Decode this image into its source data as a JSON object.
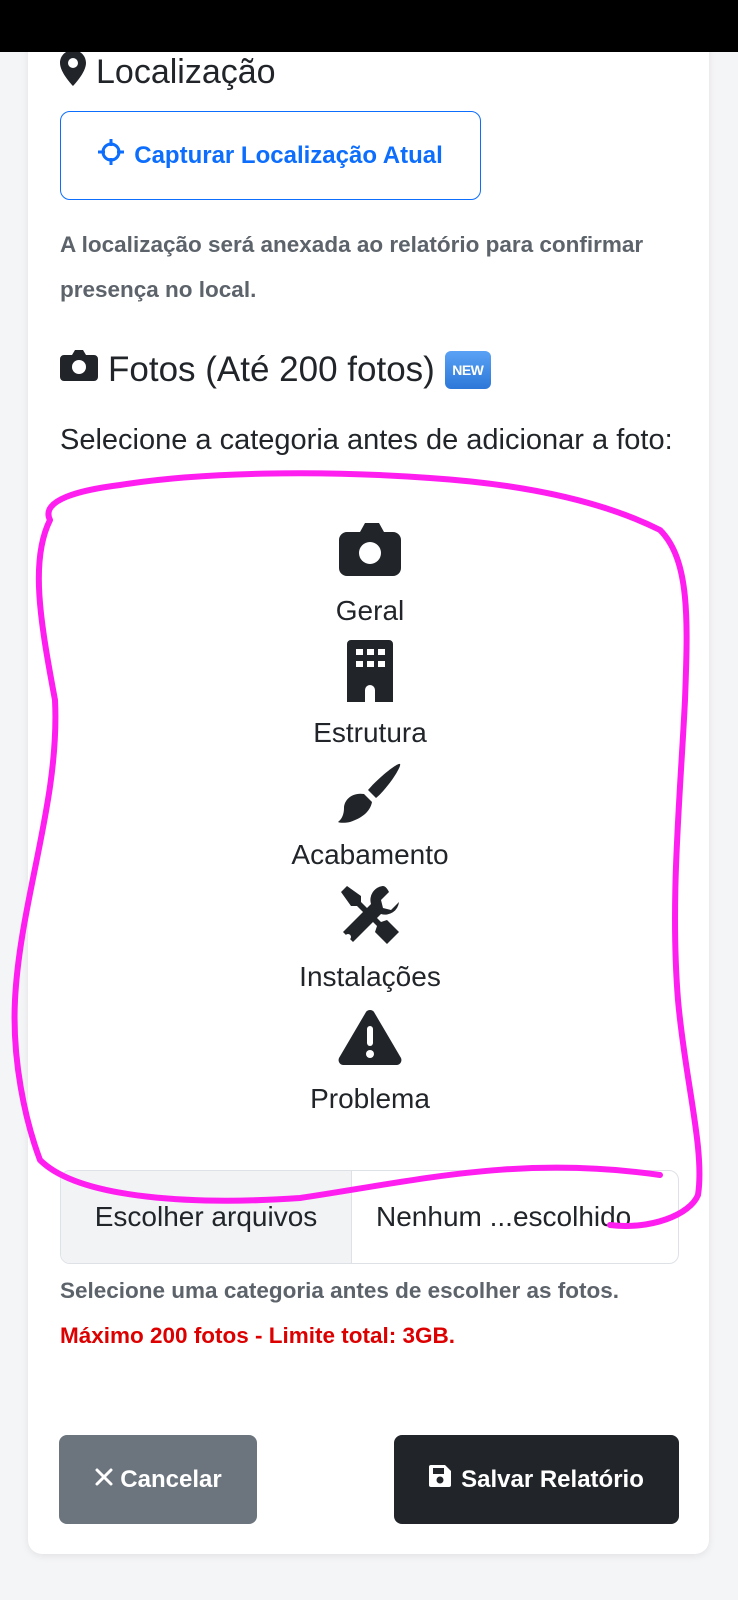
{
  "location": {
    "title": "Localização",
    "capture_button": "Capturar Localização Atual",
    "help": "A localização será anexada ao relatório para confirmar presença no local."
  },
  "photos": {
    "title": "Fotos (Até 200 fotos)",
    "new_badge": "NEW",
    "select_category": "Selecione a categoria antes de adicionar a foto:",
    "categories": [
      {
        "label": "Geral",
        "icon": "camera-icon"
      },
      {
        "label": "Estrutura",
        "icon": "building-icon"
      },
      {
        "label": "Acabamento",
        "icon": "paint-brush-icon"
      },
      {
        "label": "Instalações",
        "icon": "tools-icon"
      },
      {
        "label": "Problema",
        "icon": "warning-icon"
      }
    ],
    "file_button": "Escolher arquivos",
    "file_name": "Nenhum ...escolhido",
    "help_prefix": "Selecione uma categoria antes de escolher as fotos.",
    "help_limit": "Máximo 200 fotos - Limite total: 3GB."
  },
  "actions": {
    "cancel": "Cancelar",
    "save": "Salvar Relatório"
  },
  "colors": {
    "primary": "#0d6efd",
    "secondary": "#6c757d",
    "dark": "#212529",
    "danger": "#dc0000",
    "annotation": "#ff1ef0"
  }
}
